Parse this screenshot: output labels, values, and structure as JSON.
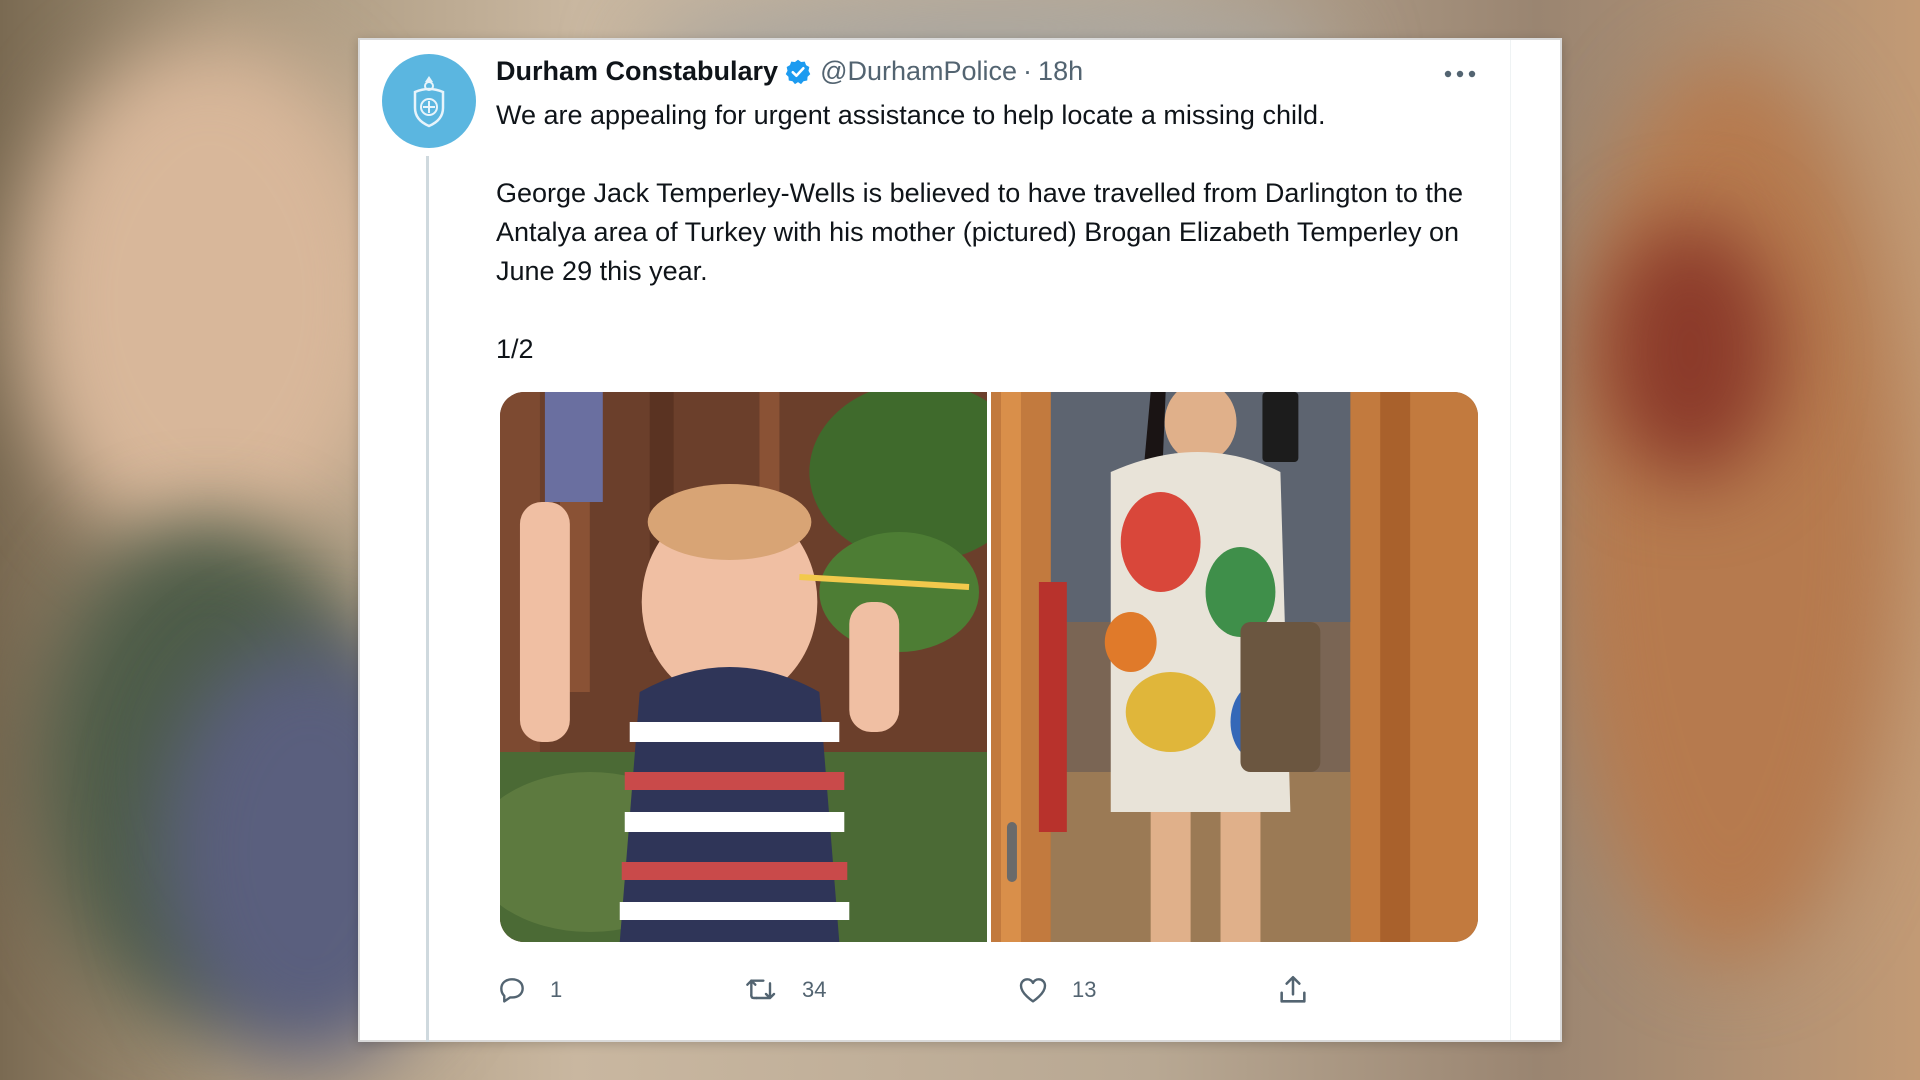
{
  "tweet": {
    "author_name": "Durham Constabulary",
    "handle": "@DurhamPolice",
    "separator": "·",
    "time": "18h",
    "verified": true,
    "text": "We are appealing for urgent assistance to help locate a missing child.\n\nGeorge Jack Temperley-Wells is believed to have travelled from Darlington to the Antalya area of Turkey with his mother (pictured) Brogan Elizabeth Temperley on June 29 this year.\n\n1/2",
    "media": [
      {
        "name": "photo-of-missing-child"
      },
      {
        "name": "mirror-selfie-of-mother"
      }
    ],
    "actions": {
      "replies": "1",
      "retweets": "34",
      "likes": "13"
    }
  },
  "icons": {
    "avatar": "police-crest-icon",
    "verified": "verified-badge-icon",
    "more": "more-options-icon",
    "reply": "reply-icon",
    "retweet": "retweet-icon",
    "like": "heart-icon",
    "share": "share-icon"
  },
  "colors": {
    "avatar_bg": "#5bb6e0",
    "verified_blue": "#1d9bf0",
    "text_primary": "#0f1419",
    "text_secondary": "#536471",
    "thread_line": "#cfd9de"
  }
}
